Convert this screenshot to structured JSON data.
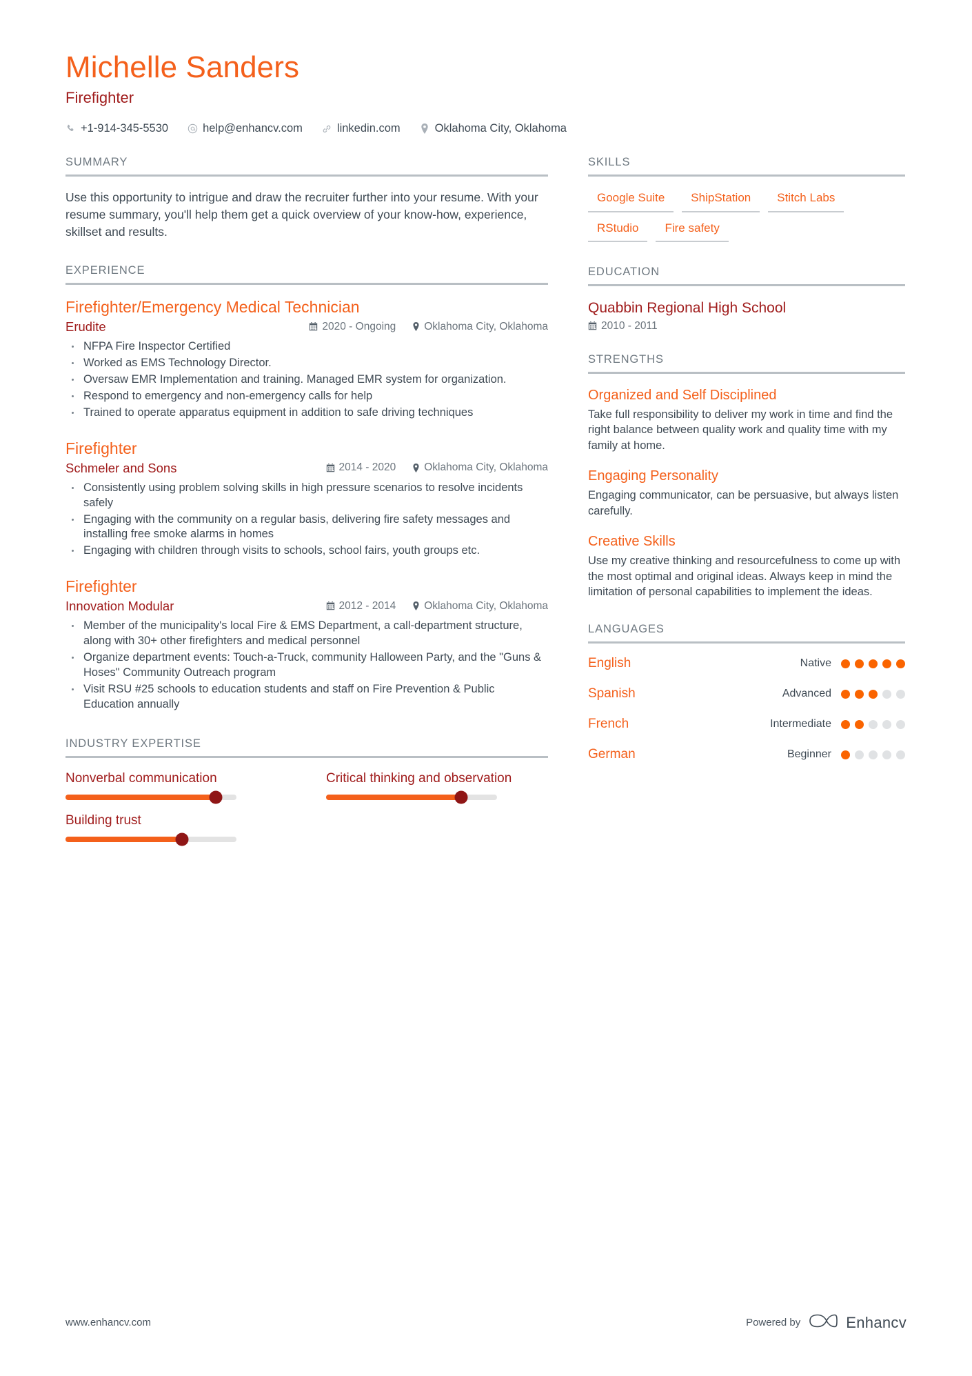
{
  "header": {
    "name": "Michelle Sanders",
    "job_title": "Firefighter",
    "contacts": [
      {
        "icon": "phone-icon",
        "value": "+1-914-345-5530"
      },
      {
        "icon": "email-icon",
        "value": "help@enhancv.com"
      },
      {
        "icon": "link-icon",
        "value": "linkedin.com"
      },
      {
        "icon": "location-pin-icon",
        "value": "Oklahoma City, Oklahoma"
      }
    ]
  },
  "summary": {
    "heading": "SUMMARY",
    "text": "Use this opportunity to intrigue and draw the recruiter further into your resume. With your resume summary, you'll help them get a quick overview of your know-how, experience, skillset and results."
  },
  "experience": {
    "heading": "EXPERIENCE",
    "entries": [
      {
        "role": "Firefighter/Emergency Medical Technician",
        "company": "Erudite",
        "dates": "2020 - Ongoing",
        "location": "Oklahoma City, Oklahoma",
        "bullets": [
          "NFPA Fire Inspector Certified",
          "Worked as EMS Technology Director.",
          "Oversaw EMR Implementation and training. Managed EMR system for organization.",
          "Respond to emergency and non-emergency calls for help",
          "Trained to operate apparatus equipment in addition to safe driving techniques"
        ]
      },
      {
        "role": "Firefighter",
        "company": "Schmeler and Sons",
        "dates": "2014 - 2020",
        "location": "Oklahoma City, Oklahoma",
        "bullets": [
          "Consistently using problem solving skills in high pressure scenarios to resolve incidents safely",
          "Engaging with the community on a regular basis, delivering fire safety messages and installing free smoke alarms in homes",
          "Engaging with children through visits to schools, school fairs, youth groups etc."
        ]
      },
      {
        "role": "Firefighter",
        "company": "Innovation Modular",
        "dates": "2012 - 2014",
        "location": "Oklahoma City, Oklahoma",
        "bullets": [
          "Member of the municipality's local Fire & EMS Department, a call-department structure, along with 30+ other firefighters and medical personnel",
          "Organize department events: Touch-a-Truck, community Halloween Party, and the \"Guns & Hoses\" Community Outreach program",
          "Visit RSU #25 schools to education students and staff on Fire Prevention & Public Education annually"
        ]
      }
    ]
  },
  "industry_expertise": {
    "heading": "INDUSTRY EXPERTISE",
    "items": [
      {
        "label": "Nonverbal communication",
        "percent": 88
      },
      {
        "label": "Critical thinking and observation",
        "percent": 79
      },
      {
        "label": "Building trust",
        "percent": 68
      }
    ]
  },
  "skills": {
    "heading": "SKILLS",
    "tags": [
      "Google Suite",
      "ShipStation",
      "Stitch Labs",
      "RStudio",
      "Fire safety"
    ]
  },
  "education": {
    "heading": "EDUCATION",
    "entries": [
      {
        "school": "Quabbin Regional High School",
        "dates": "2010 - 2011"
      }
    ]
  },
  "strengths": {
    "heading": "STRENGTHS",
    "items": [
      {
        "title": "Organized and Self Disciplined",
        "description": "Take full responsibility to deliver my work in time and find the right balance between quality work and quality time with my family at home."
      },
      {
        "title": "Engaging Personality",
        "description": "Engaging communicator, can be persuasive, but always listen carefully."
      },
      {
        "title": "Creative Skills",
        "description": "Use my creative thinking and resourcefulness to come up with the most optimal and original ideas. Always keep in mind the limitation of personal capabilities to implement the ideas."
      }
    ]
  },
  "languages": {
    "heading": "LANGUAGES",
    "items": [
      {
        "name": "English",
        "level": "Native",
        "rating": 5,
        "max": 5
      },
      {
        "name": "Spanish",
        "level": "Advanced",
        "rating": 3,
        "max": 5
      },
      {
        "name": "French",
        "level": "Intermediate",
        "rating": 2,
        "max": 5
      },
      {
        "name": "German",
        "level": "Beginner",
        "rating": 1,
        "max": 5
      }
    ]
  },
  "footer": {
    "url": "www.enhancv.com",
    "powered_by": "Powered by",
    "brand": "Enhancv"
  },
  "colors": {
    "accent_orange": "#f4601b",
    "dark_red": "#a01c1c",
    "body_text": "#3f4a54",
    "muted": "#6c757d",
    "rule": "#b9bfc4"
  }
}
